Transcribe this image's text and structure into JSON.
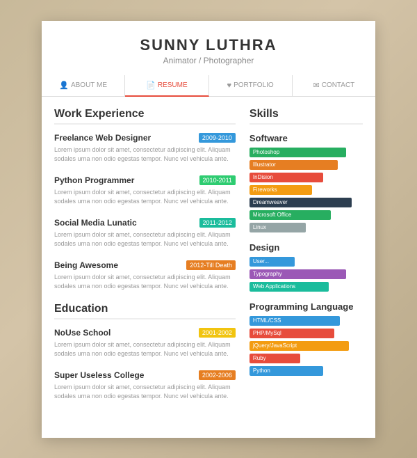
{
  "header": {
    "name": "SUNNY LUTHRA",
    "subtitle": "Animator / Photographer"
  },
  "nav": {
    "items": [
      {
        "label": "ABOUT ME",
        "icon": "👤",
        "active": false
      },
      {
        "label": "RESUME",
        "icon": "📄",
        "active": true
      },
      {
        "label": "PORTFOLIO",
        "icon": "♥",
        "active": false
      },
      {
        "label": "CONTACT",
        "icon": "✉",
        "active": false
      }
    ]
  },
  "work_experience": {
    "title": "Work Experience",
    "jobs": [
      {
        "title": "Freelance Web Designer",
        "date": "2009-2010",
        "date_class": "date-blue",
        "desc": "Lorem ipsum dolor sit amet, consectetur adipiscing elit. Aliquam sodales urna non odio egestas tempor. Nunc vel vehicula ante."
      },
      {
        "title": "Python Programmer",
        "date": "2010-2011",
        "date_class": "date-green",
        "desc": "Lorem ipsum dolor sit amet, consectetur adipiscing elit. Aliquam sodales urna non odio egestas tempor. Nunc vel vehicula ante."
      },
      {
        "title": "Social Media Lunatic",
        "date": "2011-2012",
        "date_class": "date-teal",
        "desc": "Lorem ipsum dolor sit amet, consectetur adipiscing elit. Aliquam sodales urna non odio egestas tempor. Nunc vel vehicula ante."
      },
      {
        "title": "Being Awesome",
        "date": "2012-Till Death",
        "date_class": "date-orange",
        "desc": "Lorem ipsum dolor sit amet, consectetur adipiscing elit. Aliquam sodales urna non odio egestas tempor. Nunc vel vehicula ante."
      }
    ]
  },
  "education": {
    "title": "Education",
    "items": [
      {
        "title": "NoUse School",
        "date": "2001-2002",
        "date_class": "date-yellow",
        "desc": "Lorem ipsum dolor sit amet, consectetur adipiscing elit. Aliquam sodales urna non odio egestas tempor. Nunc vel vehicula ante."
      },
      {
        "title": "Super Useless College",
        "date": "2002-2006",
        "date_class": "date-orange",
        "desc": "Lorem ipsum dolor sit amet, consectetur adipiscing elit. Aliquam sodales urna non odio egestas tempor. Nunc vel vehicula ante."
      }
    ]
  },
  "skills": {
    "title": "Skills",
    "software": {
      "title": "Software",
      "items": [
        {
          "name": "Photoshop",
          "class": "s-photoshop"
        },
        {
          "name": "Illustrator",
          "class": "s-illustrator"
        },
        {
          "name": "InDision",
          "class": "s-indesign"
        },
        {
          "name": "Fireworks",
          "class": "s-fireworks"
        },
        {
          "name": "Dreamweaver",
          "class": "s-dreamweaver"
        },
        {
          "name": "Microsoft Office",
          "class": "s-msoffice"
        },
        {
          "name": "Linux",
          "class": "s-linux"
        }
      ]
    },
    "design": {
      "title": "Design",
      "items": [
        {
          "name": "User...",
          "class": "s-ux"
        },
        {
          "name": "Typography",
          "class": "s-typography"
        },
        {
          "name": "Web Applications",
          "class": "s-webapps"
        }
      ]
    },
    "programming": {
      "title": "Programming Language",
      "items": [
        {
          "name": "HTML/CSS",
          "class": "s-htmlcss"
        },
        {
          "name": "PHP/MySql",
          "class": "s-phpmysql"
        },
        {
          "name": "jQuery/JavaScript",
          "class": "s-jquery"
        },
        {
          "name": "Ruby",
          "class": "s-ruby"
        },
        {
          "name": "Python",
          "class": "s-python"
        }
      ]
    }
  }
}
